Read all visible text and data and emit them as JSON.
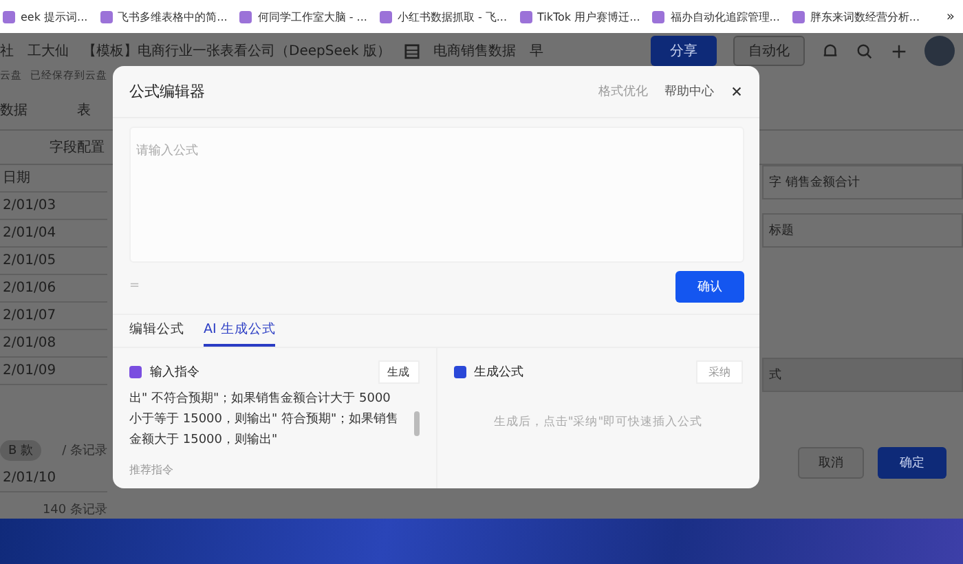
{
  "bookmarks": [
    "eek 提示词...",
    "飞书多维表格中的简...",
    "何同学工作室大脑 - ...",
    "小红书数据抓取 - 飞...",
    "TikTok 用户赛博迁...",
    "福办自动化追踪管理...",
    "胖东来词数经营分析..."
  ],
  "bookmarks_more": "»",
  "header": {
    "crumbs": [
      "社",
      "工大仙"
    ],
    "doc_title": "【模板】电商行业一张表看公司（DeepSeek 版）",
    "table_name": "电商销售数据",
    "tail": "早",
    "sub_left": "云盘",
    "sub_status": "已经保存到云盘",
    "share": "分享",
    "automation": "自动化"
  },
  "toolbar": {
    "view": "数据",
    "table_tab": "表",
    "field_config": "字段配置"
  },
  "date_column": {
    "heading": "日期",
    "rows": [
      "2/01/03",
      "2/01/04",
      "2/01/05",
      "2/01/06",
      "2/01/07",
      "2/01/08",
      "2/01/09"
    ]
  },
  "group": {
    "chip": "B 款",
    "count": "/ 条记录",
    "row": "2/01/10",
    "total": "140 条记录"
  },
  "side_panel": {
    "field_label": "字 销售金额合计",
    "title_field": "标题",
    "formula": "式",
    "cancel": "取消",
    "ok": "确定"
  },
  "dialog": {
    "title": "公式编辑器",
    "format": {
      "label": "格式优化",
      "disabled": true
    },
    "help": "帮助中心",
    "placeholder": "请输入公式",
    "equals": "=",
    "confirm": "确认",
    "tabs": [
      {
        "label": "编辑公式",
        "selected": false
      },
      {
        "label": "AI 生成公式",
        "selected": true
      }
    ],
    "prompt": {
      "title": "输入指令",
      "generate": "生成",
      "text": "出\" 不符合预期\"；如果销售金额合计大于 5000 小于等于 15000，则输出\" 符合预期\"；如果销售金额大于 15000，则输出\"",
      "recommend": "推荐指令"
    },
    "result": {
      "title": "生成公式",
      "adopt": {
        "label": "采纳",
        "disabled": true
      },
      "hint": "生成后，点击\"采纳\"即可快速插入公式"
    }
  }
}
